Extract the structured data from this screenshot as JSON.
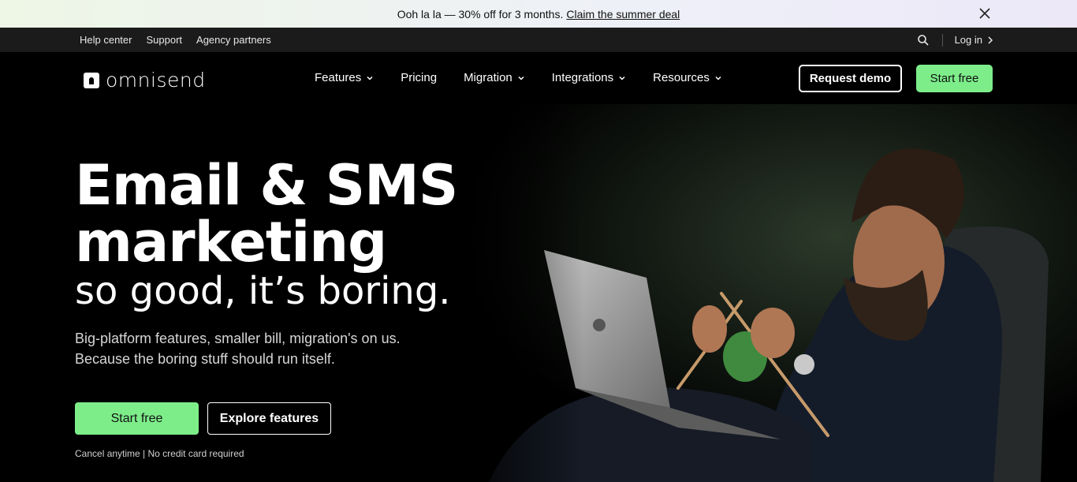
{
  "promo": {
    "text": "Ooh la la — 30% off for 3 months.",
    "link": "Claim the summer deal",
    "close_icon": "close-icon"
  },
  "utility": {
    "links": [
      "Help center",
      "Support",
      "Agency partners"
    ],
    "search_icon": "search-icon",
    "login": "Log in"
  },
  "nav": {
    "logo": "omnisend",
    "menu": [
      {
        "label": "Features",
        "dropdown": true
      },
      {
        "label": "Pricing",
        "dropdown": false
      },
      {
        "label": "Migration",
        "dropdown": true
      },
      {
        "label": "Integrations",
        "dropdown": true
      },
      {
        "label": "Resources",
        "dropdown": true
      }
    ],
    "request_demo": "Request demo",
    "start_free": "Start free"
  },
  "hero": {
    "headline_line1": "Email & SMS",
    "headline_line2": "marketing",
    "headline_line3": "so good, it’s boring.",
    "subtext_line1": "Big-platform features, smaller bill, migration's on us.",
    "subtext_line2": "Because the boring stuff should run itself.",
    "cta_primary": "Start free",
    "cta_secondary": "Explore features",
    "note": "Cancel anytime | No credit card required",
    "image": "man-knitting-with-laptop-photo"
  },
  "colors": {
    "accent_green": "#7ded8a",
    "background": "#000000",
    "utility_bar": "#1b1b1b"
  }
}
